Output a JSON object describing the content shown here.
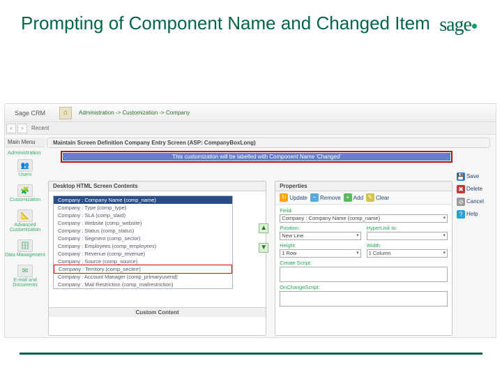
{
  "slide": {
    "title": "Prompting of Component Name and Changed Item"
  },
  "logo": {
    "text": "sage"
  },
  "app": {
    "brand": "Sage CRM",
    "breadcrumb": "Administration -> Customization -> Company",
    "recent_label": "Recent",
    "page_title": "Maintain Screen Definition Company Entry Screen (ASP: CompanyBoxLong)",
    "notice": "This customization will be labelled with Component Name 'Changed'"
  },
  "sidebar": {
    "main_menu": "Main Menu",
    "group": "Administration",
    "items": [
      {
        "label": "Users",
        "emoji": "👥"
      },
      {
        "label": "Customization",
        "emoji": "🧩"
      },
      {
        "label": "Advanced Customization",
        "emoji": "📐"
      },
      {
        "label": "Data Management",
        "emoji": "🗄"
      },
      {
        "label": "E-mail and Documents",
        "emoji": "✉"
      }
    ]
  },
  "right_actions": {
    "save": "Save",
    "delete": "Delete",
    "cancel": "Cancel",
    "help": "Help"
  },
  "left_panel": {
    "title": "Desktop HTML Screen Contents",
    "custom_title": "Custom Content",
    "items": [
      {
        "label": "Company : Company Name (comp_name)",
        "selected": true,
        "highlight": false
      },
      {
        "label": "Company : Type (comp_type)"
      },
      {
        "label": "Company : SLA (comp_slaid)"
      },
      {
        "label": "Company : Website (comp_website)"
      },
      {
        "label": "Company : Status (comp_status)"
      },
      {
        "label": "Company : Segment (comp_sector)"
      },
      {
        "label": "Company : Employees (comp_employees)"
      },
      {
        "label": "Company : Revenue (comp_revenue)"
      },
      {
        "label": "Company : Source (comp_source)"
      },
      {
        "label": "Company : Territory (comp_secterr)",
        "highlight": true
      },
      {
        "label": "Company : Account Manager (comp_primaryuserid)"
      },
      {
        "label": "Company : Mail Restriction (comp_mailrestriction)"
      }
    ]
  },
  "right_panel": {
    "title": "Properties",
    "toolbar": {
      "update": "Update",
      "remove": "Remove",
      "add": "Add",
      "clear": "Clear"
    },
    "labels": {
      "field": "Field:",
      "position": "Position:",
      "hyperlink": "HyperLink to:",
      "height": "Height:",
      "width": "Width:",
      "create_script": "Create Script:",
      "onchange_script": "OnChangeScript:"
    },
    "values": {
      "field": "Company : Company Name (comp_name)",
      "position": "New Line",
      "height": "1 Row",
      "width": "1 Column",
      "hyperlink": ""
    }
  }
}
